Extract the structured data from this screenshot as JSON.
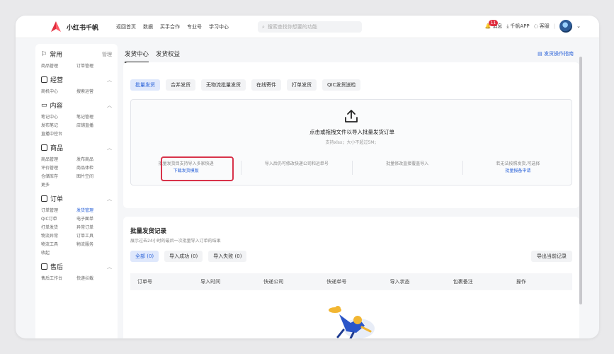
{
  "app": {
    "brand": "小红书千帆",
    "nav": [
      "返回首页",
      "数据",
      "买手合作",
      "专业号",
      "学习中心"
    ],
    "search_placeholder": "搜索查找你想要的功能",
    "notif_count": "11",
    "notif_label": "消息",
    "download_label": "千帆APP",
    "service_label": "客服",
    "colors": {
      "accent": "#2b63d9",
      "brand_red": "#e02e3f",
      "highlight": "#d8334a"
    }
  },
  "sidebar": {
    "sections": [
      {
        "title": "常用",
        "icon": "flag-icon",
        "extra": "管理",
        "items": [
          "商品管理",
          "订单管理"
        ]
      },
      {
        "title": "经营",
        "icon": "chart-icon",
        "items": [
          "商机中心",
          "搜索运营"
        ]
      },
      {
        "title": "内容",
        "icon": "book-icon",
        "items": [
          "笔记中心",
          "笔记管理",
          "发布笔记",
          "店铺直播",
          "直播中控台"
        ]
      },
      {
        "title": "商品",
        "icon": "bag-icon",
        "items": [
          "商品管理",
          "发布商品",
          "评价管理",
          "商品体检",
          "仓储库存",
          "图片空间",
          "更多"
        ]
      },
      {
        "title": "订单",
        "icon": "order-icon",
        "items": [
          "订单管理",
          "发货管理",
          "QIC订单",
          "电子面单",
          "打单发货",
          "异常订单",
          "物流异常",
          "订单工具",
          "物流工具",
          "物流服务",
          "收起"
        ],
        "active": "发货管理"
      },
      {
        "title": "售后",
        "icon": "aftersale-icon",
        "items": [
          "售后工作台",
          "快递拦截"
        ]
      }
    ]
  },
  "main": {
    "tabs": [
      "发货中心",
      "发货权益"
    ],
    "guide_label": "发货操作指南",
    "chips": [
      "批量发货",
      "合并发货",
      "无物流批量发货",
      "在线寄件",
      "打单发货",
      "QIC发货送检"
    ],
    "upload": {
      "title": "点击或拖拽文件以导入批量发货订单",
      "subtitle": "支持xlsx；大小不超过5M；",
      "step1_text": "批量发货目支持导入多家快递",
      "step1_link": "下载发货模版",
      "step2_text": "导入后仍可修改快递公司和运单号",
      "step3_text": "批量修改直接覆盖导入",
      "step4_text": "若无法按照发货,可选择",
      "step4_link": "批量报备申请"
    },
    "records": {
      "title": "批量发货记录",
      "subtitle": "展示过去24小时的最后一次批量导入订单的结果",
      "filter_tabs": [
        "全部 (0)",
        "导入成功 (0)",
        "导入失败 (0)"
      ],
      "export_label": "导出当前记录",
      "columns": [
        "订单号",
        "导入时间",
        "快递公司",
        "快递单号",
        "导入状态",
        "包裹备注",
        "操作"
      ]
    }
  }
}
